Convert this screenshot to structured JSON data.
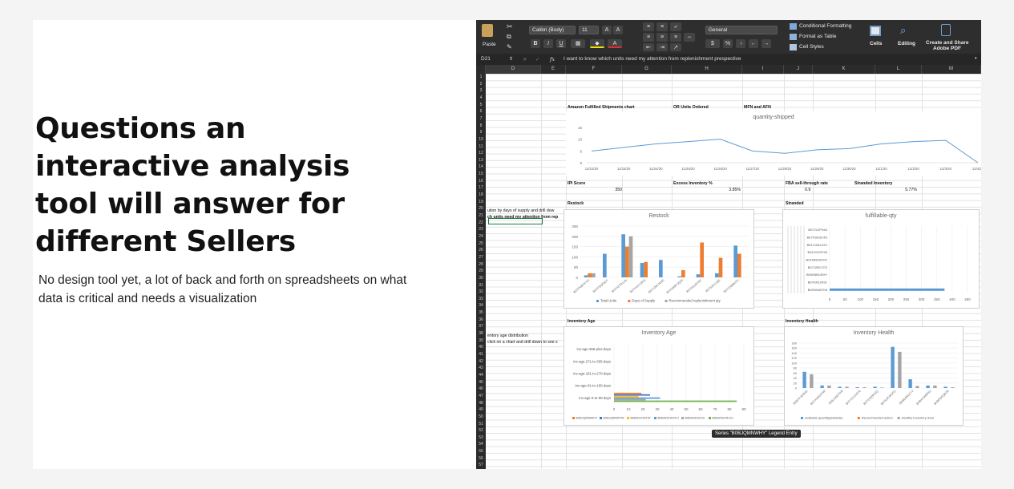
{
  "slide": {
    "heading_lines": [
      "Questions an",
      "interactive analysis",
      "tool will answer for",
      "different Sellers"
    ],
    "subtitle": "No design tool yet, a lot of back and forth on spreadsheets on what data is critical and needs a visualization"
  },
  "ribbon": {
    "paste": "Paste",
    "font_name": "Calibri (Body)",
    "font_size": "11",
    "bold": "B",
    "italic": "I",
    "underline": "U",
    "number_format": "General",
    "currency": "$",
    "percent": "%",
    "comma": " ›",
    "conditional_formatting": "Conditional Formatting",
    "format_as_table": "Format as Table",
    "cell_styles": "Cell Styles",
    "cells": "Cells",
    "editing": "Editing",
    "create_share_1": "Create and Share",
    "create_share_2": "Adobe PDF"
  },
  "formula_bar": {
    "cell_ref": "D21",
    "fx": "fx",
    "content": "I want to know which units need my attention from replenishment prespective"
  },
  "columns": [
    "D",
    "E",
    "F",
    "G",
    "H",
    "I",
    "J",
    "K",
    "L",
    "M"
  ],
  "rows_count": 57,
  "cells": {
    "amazon_fulfilled": "Amazon Fulfilled Shipments chart",
    "or_units": "OR Units Ordered",
    "mfn_afn": "MFN and AFN",
    "ipi_score_label": "IPI Score",
    "ipi_score_value": "350",
    "excess_label": "Excess Inventory %",
    "excess_value": "3.85%",
    "fba_label": "FBA sell-through rate",
    "fba_value": "0.9",
    "stranded_label": "Stranded Inventory",
    "stranded_value": "5.77%",
    "restock_label": "Restock",
    "stranded_label2": "Stranded",
    "d20": "ution by days of supply and drill dow",
    "d21": "ch units need my attention from rep",
    "inv_age_label": "Inventory Age",
    "inv_health_label": "Inventory Health",
    "d38": "entory age distribution",
    "d39": "click on a chart and drill down to see s"
  },
  "chart_data": [
    {
      "type": "line",
      "title": "quantity-shipped",
      "x": [
        "11/22/20",
        "11/23/20",
        "11/24/20",
        "11/25/20",
        "11/26/20",
        "11/27/20",
        "11/28/20",
        "11/29/20",
        "11/30/20",
        "12/1/20",
        "12/2/20",
        "12/3/20",
        "12/4/20"
      ],
      "values": [
        5,
        6.5,
        8,
        9,
        10,
        5,
        4,
        5.5,
        6,
        8,
        9,
        9.5,
        0
      ],
      "ylim": [
        0,
        15
      ],
      "yticks": [
        0,
        5,
        10,
        15
      ],
      "color": "#5b9bd5"
    },
    {
      "type": "bar",
      "title": "Restock",
      "categories": [
        "B07FNBPXYG",
        "B07FSQFBJT",
        "B07H2TR1JN",
        "B07HU1Y3FQ",
        "B07JJWLNMS",
        "B07NMBT2QM",
        "B07NS1RYAT",
        "B07S3H7J6E",
        "B07ZXB8KPC"
      ],
      "series": [
        {
          "name": "Total Units",
          "values": [
            10,
            115,
            210,
            70,
            85,
            5,
            15,
            20,
            155
          ],
          "color": "#5b9bd5"
        },
        {
          "name": "Days of Supply",
          "values": [
            20,
            0,
            150,
            75,
            0,
            35,
            170,
            95,
            115
          ],
          "color": "#ed7d31"
        },
        {
          "name": "Recommended replenishment qty",
          "values": [
            20,
            0,
            200,
            0,
            0,
            0,
            0,
            0,
            0
          ],
          "color": "#a5a5a5"
        }
      ],
      "ylim": [
        0,
        250
      ],
      "yticks": [
        0,
        50,
        100,
        150,
        200,
        250
      ]
    },
    {
      "type": "bar",
      "title": "fulfillable-qty",
      "orientation": "horizontal",
      "categories": [
        "B07212PX64",
        "B07XSD3C4S",
        "B01C43U1GX",
        "B012XZGF45",
        "B01A8SGDXO",
        "B07J2B1TCS",
        "B000NBUSHY",
        "B07KR19X51",
        "B00SK66TK8"
      ],
      "values": [
        0,
        0,
        0,
        0,
        0,
        0,
        0,
        0,
        375
      ],
      "xlim": [
        0,
        450
      ],
      "xticks": [
        0,
        50,
        100,
        150,
        200,
        250,
        300,
        350,
        400,
        450
      ],
      "color": "#5b9bd5"
    },
    {
      "type": "bar",
      "title": "Inventory Age",
      "orientation": "horizontal",
      "categories": [
        "inv-age-365-plus-days",
        "inv-age-271-to-365-days",
        "inv-age-181-to-270-days",
        "inv-age-91-to-180-days",
        "inv-age-0-to-90-days"
      ],
      "series": [
        {
          "name": "B0BJQMNWHY",
          "values": [
            0,
            0,
            0,
            0,
            19
          ],
          "color": "#ed7d31"
        },
        {
          "name": "B0BJQNNPFW",
          "values": [
            0,
            0,
            0,
            0,
            25
          ],
          "color": "#4472c4"
        },
        {
          "name": "B0BHSVJ6TW",
          "values": [
            0,
            0,
            0,
            0,
            17
          ],
          "color": "#ffc000"
        },
        {
          "name": "B0BHDFWSTH",
          "values": [
            0,
            0,
            0,
            0,
            32
          ],
          "color": "#5b9bd5"
        },
        {
          "name": "B0BHSKSXJD",
          "values": [
            0,
            0,
            0,
            0,
            22
          ],
          "color": "#a5a5a5"
        },
        {
          "name": "B0BH5SXRJ1C",
          "values": [
            0,
            0,
            0,
            0,
            85
          ],
          "color": "#70ad47"
        }
      ],
      "xlim": [
        0,
        90
      ],
      "xticks": [
        0,
        10,
        20,
        30,
        40,
        50,
        60,
        70,
        80,
        90
      ]
    },
    {
      "type": "bar",
      "title": "Inventory Health",
      "categories": [
        "B0BTFJD9HD",
        "B07XJN1ZHW",
        "B06XJ8CFKB",
        "B07TGY2VKN",
        "B07V3Q9CZQ",
        "B07NJKMUFG",
        "B08N4N1ZTY",
        "B0BXKW9F81",
        "B09PNFQB2B"
      ],
      "series": [
        {
          "name": "available quantity(sellable)",
          "values": [
            65,
            10,
            5,
            3,
            5,
            165,
            35,
            10,
            5
          ],
          "color": "#5b9bd5"
        },
        {
          "name": "Recommended action",
          "values": [
            0,
            0,
            0,
            0,
            0,
            0,
            0,
            0,
            0
          ],
          "color": "#ed7d31"
        },
        {
          "name": "Healthy Inventory level",
          "values": [
            55,
            10,
            5,
            3,
            2,
            145,
            8,
            10,
            3
          ],
          "color": "#a5a5a5"
        }
      ],
      "ylim": [
        0,
        180
      ],
      "yticks": [
        0,
        20,
        40,
        60,
        80,
        100,
        120,
        140,
        160,
        180
      ]
    }
  ],
  "tooltip": "Series \"B0BJQMNWHY\" Legend Entry"
}
